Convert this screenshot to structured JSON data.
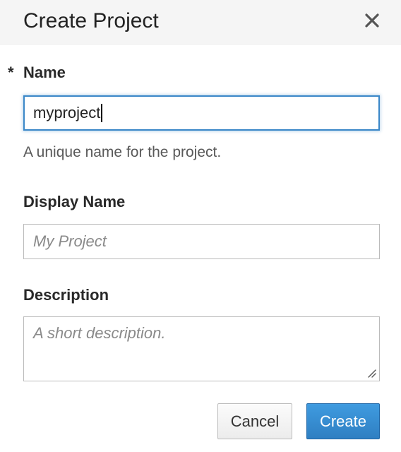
{
  "dialog": {
    "title": "Create Project",
    "close_icon": "close-icon"
  },
  "form": {
    "name": {
      "required_marker": "*",
      "label": "Name",
      "value": "myproject",
      "help": "A unique name for the project."
    },
    "display_name": {
      "label": "Display Name",
      "value": "",
      "placeholder": "My Project"
    },
    "description": {
      "label": "Description",
      "value": "",
      "placeholder": "A short description."
    }
  },
  "actions": {
    "cancel_label": "Cancel",
    "create_label": "Create"
  },
  "colors": {
    "primary": "#3a87c8",
    "header_bg": "#f5f5f5"
  }
}
